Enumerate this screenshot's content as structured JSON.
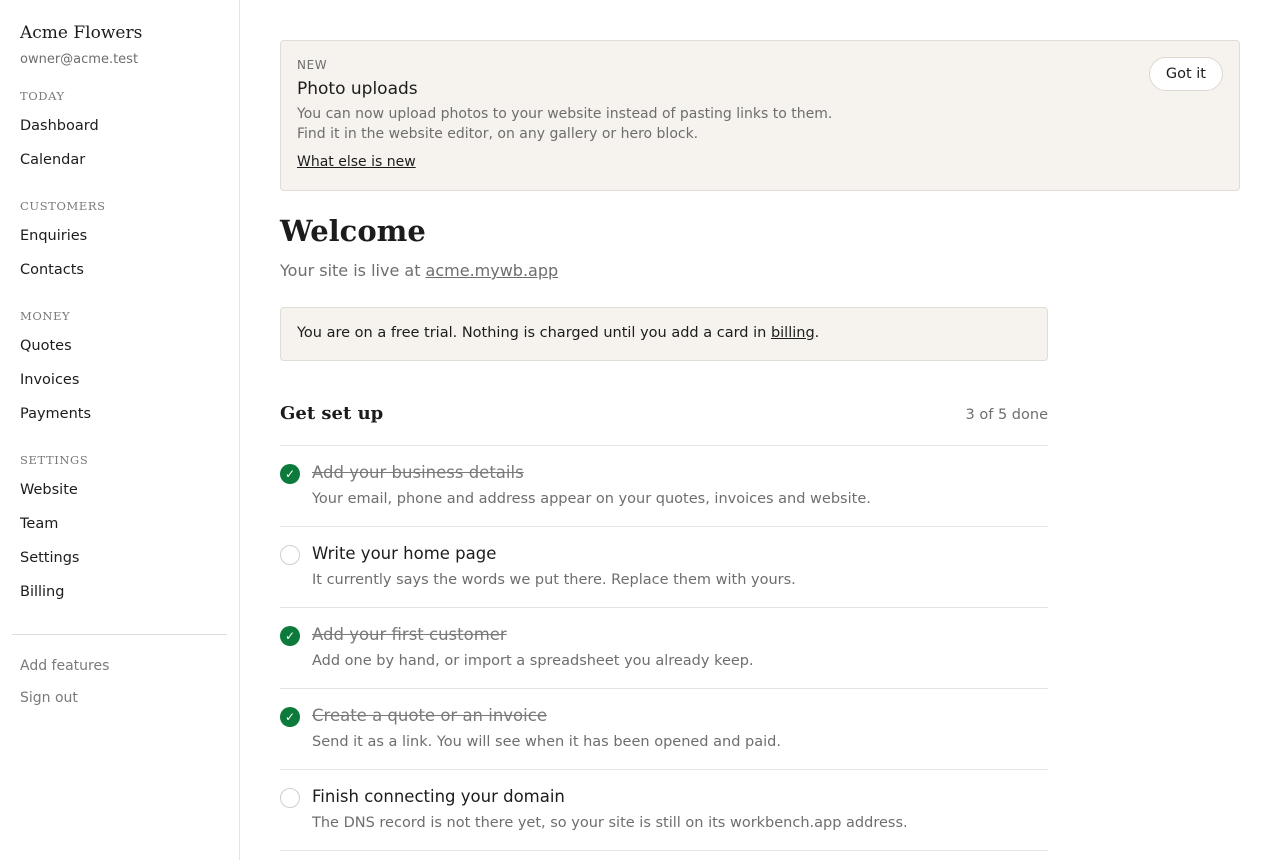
{
  "sidebar": {
    "brand": "Acme Flowers",
    "email": "owner@acme.test",
    "sections": [
      {
        "heading": "TODAY",
        "items": [
          "Dashboard",
          "Calendar"
        ]
      },
      {
        "heading": "CUSTOMERS",
        "items": [
          "Enquiries",
          "Contacts"
        ]
      },
      {
        "heading": "MONEY",
        "items": [
          "Quotes",
          "Invoices",
          "Payments"
        ]
      },
      {
        "heading": "SETTINGS",
        "items": [
          "Website",
          "Team",
          "Settings",
          "Billing"
        ]
      }
    ],
    "footer_links": [
      "Add features",
      "Sign out"
    ]
  },
  "notice": {
    "tag": "NEW",
    "title": "Photo uploads",
    "body_line1": "You can now upload photos to your website instead of pasting links to them.",
    "body_line2": "Find it in the website editor, on any gallery or hero block.",
    "link": "What else is new",
    "dismiss": "Got it"
  },
  "welcome": {
    "title": "Welcome",
    "live_prefix": "Your site is live at ",
    "live_link": "acme.mywb.app"
  },
  "trial": {
    "text_before": "You are on a free trial. Nothing is charged until you add a card in ",
    "link": "billing",
    "text_after": "."
  },
  "setup": {
    "title": "Get set up",
    "progress": "3 of 5 done",
    "check_glyph": "✓",
    "tasks": [
      {
        "title": "Add your business details",
        "desc": "Your email, phone and address appear on your quotes, invoices and website.",
        "done": true
      },
      {
        "title": "Write your home page",
        "desc": "It currently says the words we put there. Replace them with yours.",
        "done": false
      },
      {
        "title": "Add your first customer",
        "desc": "Add one by hand, or import a spreadsheet you already keep.",
        "done": true
      },
      {
        "title": "Create a quote or an invoice",
        "desc": "Send it as a link. You will see when it has been opened and paid.",
        "done": true
      },
      {
        "title": "Finish connecting your domain",
        "desc": "The DNS record is not there yet, so your site is still on its workbench.app address.",
        "done": false
      }
    ]
  },
  "colors": {
    "accent_done": "#0b7a3a",
    "panel_bg": "#f6f3ee"
  }
}
